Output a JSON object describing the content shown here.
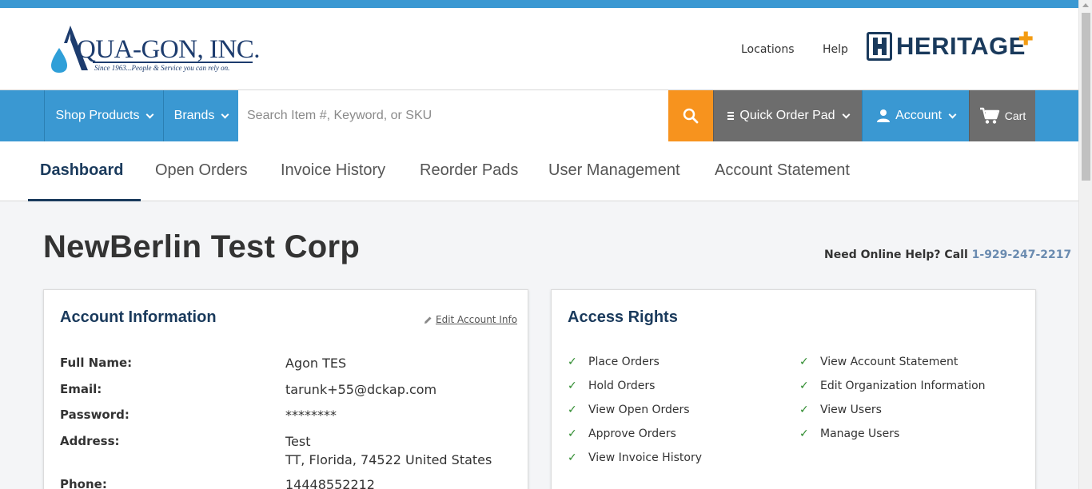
{
  "header": {
    "logo_text": "QUA-GON, INC.",
    "logo_tagline": "Since 1963...People & Service you can rely on.",
    "links": [
      "Locations",
      "Help"
    ],
    "partner_logo": "HERITAGE"
  },
  "navbar": {
    "shop_products": "Shop Products",
    "brands": "Brands",
    "search_placeholder": "Search Item #, Keyword, or SKU",
    "quick_order": "Quick Order Pad",
    "account": "Account",
    "cart": "Cart"
  },
  "tabs": [
    "Dashboard",
    "Open Orders",
    "Invoice History",
    "Reorder Pads",
    "User Management",
    "Account Statement"
  ],
  "page": {
    "company_name": "NewBerlin Test Corp",
    "help_prefix": "Need Online Help? Call",
    "help_phone": "1-929-247-2217"
  },
  "account_info": {
    "title": "Account Information",
    "edit_link": "Edit Account Info",
    "full_name_label": "Full Name:",
    "full_name": "Agon TES",
    "email_label": "Email:",
    "email": "tarunk+55@dckap.com",
    "password_label": "Password:",
    "password": "********",
    "address_label": "Address:",
    "address_line1": "Test",
    "address_line2": "TT, Florida, 74522 United States",
    "phone_label": "Phone:",
    "phone": "14448552212"
  },
  "access_rights": {
    "title": "Access Rights",
    "left": [
      "Place Orders",
      "Hold Orders",
      "View Open Orders",
      "Approve Orders",
      "View Invoice History"
    ],
    "right": [
      "View Account Statement",
      "Edit Organization Information",
      "View Users",
      "Manage Users"
    ]
  },
  "colors": {
    "brand_blue": "#3a98d2",
    "navy": "#1a3a5c",
    "accent_orange": "#f7931e",
    "check_green": "#2e8b2e"
  }
}
